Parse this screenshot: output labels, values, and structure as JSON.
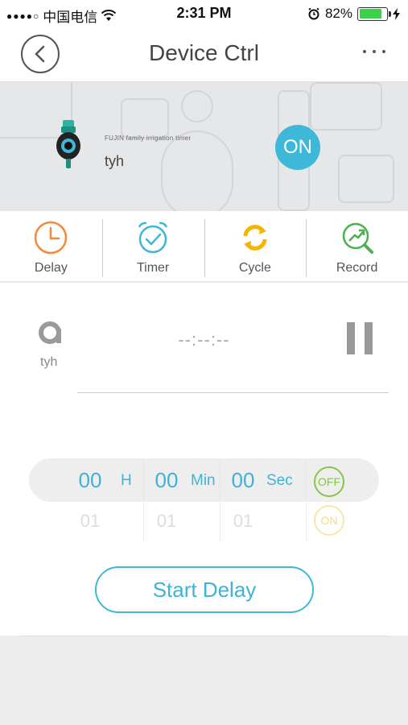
{
  "status_bar": {
    "carrier": "中国电信",
    "time": "2:31 PM",
    "battery": "82%",
    "battery_level": 0.82,
    "icons": [
      "signal-dots-icon",
      "wifi-icon",
      "alarm-icon",
      "battery-icon",
      "charging-icon"
    ]
  },
  "nav": {
    "title": "Device Ctrl",
    "back_icon": "chevron-left-icon",
    "more_icon": "more-dots-icon"
  },
  "device": {
    "brand": "FUJIN family irrigation timer",
    "name": "tyh",
    "power_label": "ON",
    "accent": "#3fb7d8"
  },
  "tabs": [
    {
      "label": "Delay",
      "icon": "clock-icon",
      "color": "#f08a3c",
      "active": true
    },
    {
      "label": "Timer",
      "icon": "alarm-check-icon",
      "color": "#3fb7d8"
    },
    {
      "label": "Cycle",
      "icon": "cycle-arrows-icon",
      "color": "#f5b400"
    },
    {
      "label": "Record",
      "icon": "record-search-icon",
      "color": "#4caf50"
    }
  ],
  "panel": {
    "status_name": "tyh",
    "countdown": "--:--:--",
    "pause_icon": "pause-icon"
  },
  "picker": {
    "hours": "00",
    "hours_next": "01",
    "hours_unit": "H",
    "minutes": "00",
    "minutes_next": "01",
    "minutes_unit": "Min",
    "seconds": "00",
    "seconds_next": "01",
    "seconds_unit": "Sec",
    "state_selected": "OFF",
    "state_next": "ON"
  },
  "start_button": "Start Delay"
}
